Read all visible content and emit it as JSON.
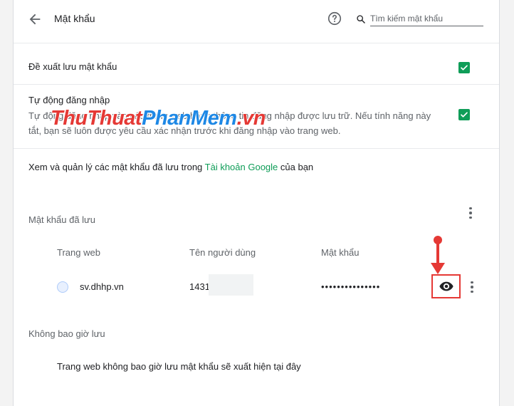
{
  "header": {
    "title": "Mật khẩu",
    "search_placeholder": "Tìm kiếm mật khẩu"
  },
  "settings": {
    "offer_to_save": {
      "label": "Đề xuất lưu mật khẩu",
      "checked": true
    },
    "auto_sign_in": {
      "label": "Tự động đăng nhập",
      "description": "Tự động đăng nhập vào các trang web bằng thông tin đăng nhập được lưu trữ. Nếu tính năng này tắt, bạn sẽ luôn được yêu cầu xác nhận trước khi đăng nhập vào trang web.",
      "checked": true
    },
    "manage": {
      "prefix": "Xem và quản lý các mật khẩu đã lưu trong ",
      "link": "Tài khoản Google",
      "suffix": " của bạn"
    }
  },
  "saved_passwords": {
    "title": "Mật khẩu đã lưu",
    "columns": {
      "site": "Trang web",
      "username": "Tên người dùng",
      "password": "Mật khẩu"
    },
    "rows": [
      {
        "site": "sv.dhhp.vn",
        "username": "1431",
        "password": "•••••••••••••••"
      }
    ]
  },
  "never_saved": {
    "title": "Không bao giờ lưu",
    "empty_text": "Trang web không bao giờ lưu mật khẩu sẽ xuất hiện tại đây"
  },
  "watermark": {
    "part1": "ThuThuat",
    "part2": "PhanMem",
    "part3": ".vn"
  },
  "colors": {
    "accent": "#0f9d58",
    "annotation": "#e53935"
  },
  "icons": [
    "back-arrow-icon",
    "help-icon",
    "search-icon",
    "check-icon",
    "more-vert-icon",
    "site-favicon-icon",
    "eye-icon"
  ]
}
